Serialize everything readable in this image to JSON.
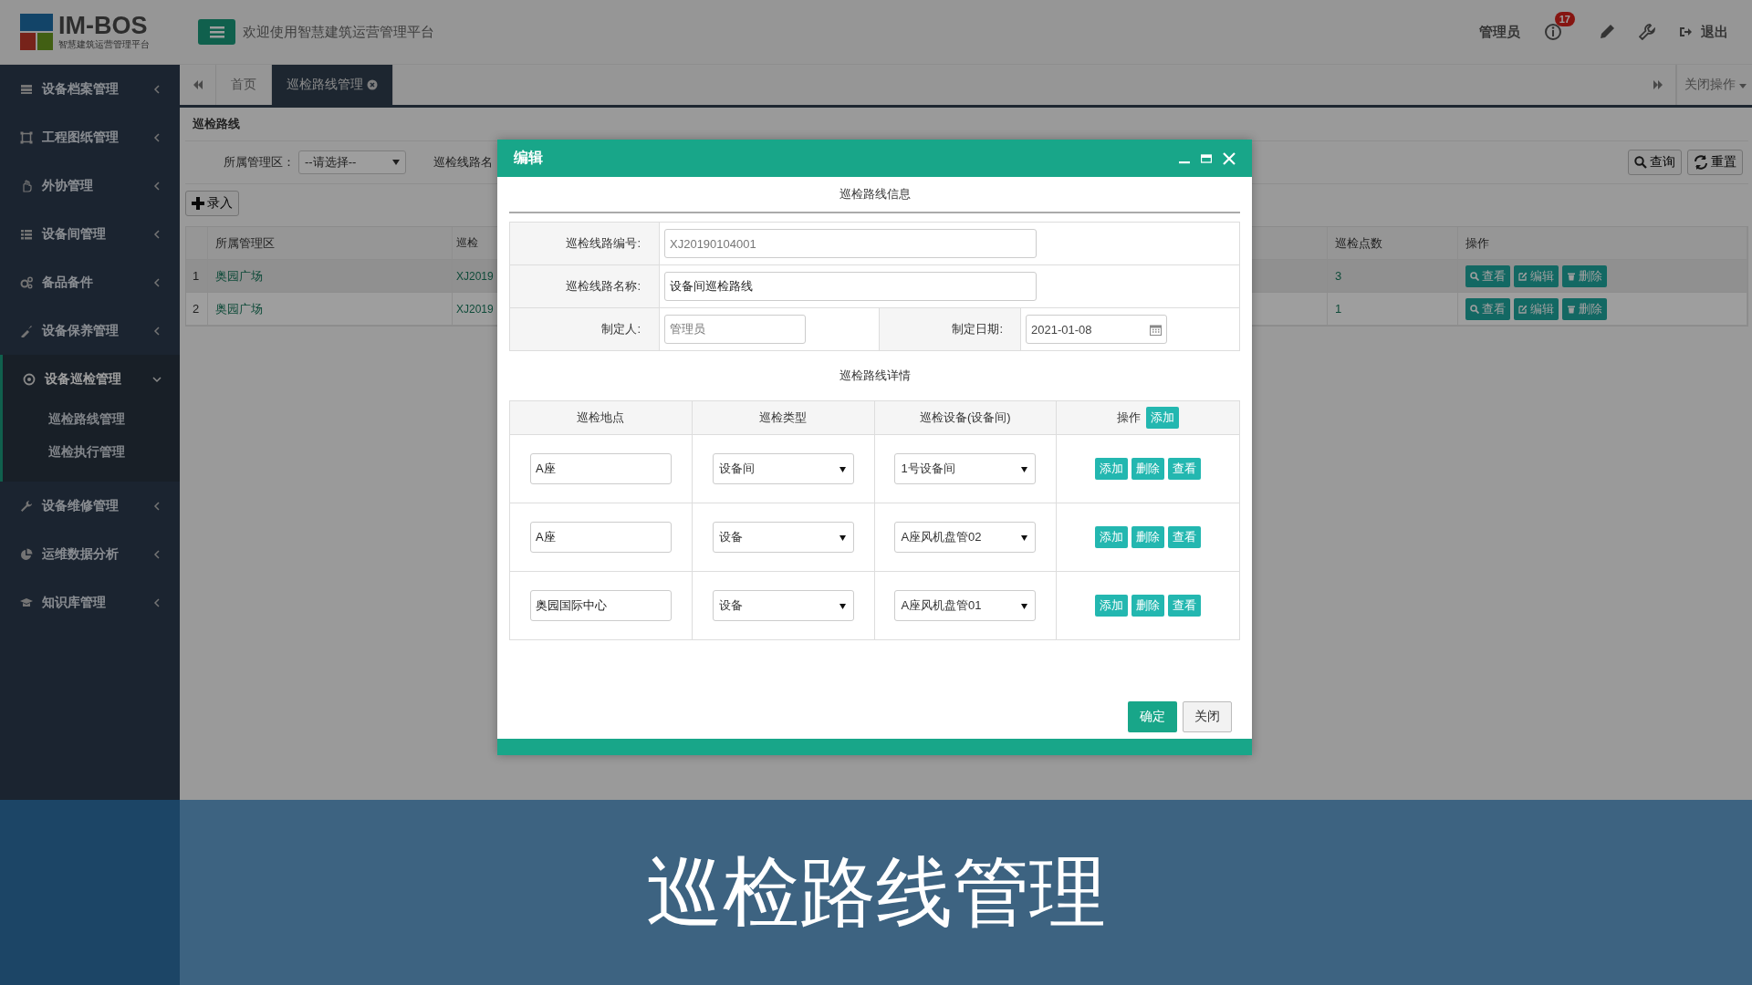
{
  "header": {
    "logo_title": "IM-BOS",
    "logo_subtitle": "智慧建筑运营管理平台",
    "welcome": "欢迎使用智慧建筑运营管理平台",
    "user": "管理员",
    "notification_count": "17",
    "logout": "退出"
  },
  "sidebar": {
    "items": [
      {
        "label": "设备档案管理",
        "expanded": false
      },
      {
        "label": "工程图纸管理",
        "expanded": false
      },
      {
        "label": "外协管理",
        "expanded": false
      },
      {
        "label": "设备间管理",
        "expanded": false
      },
      {
        "label": "备品备件",
        "expanded": false
      },
      {
        "label": "设备保养管理",
        "expanded": false
      },
      {
        "label": "设备巡检管理",
        "expanded": true,
        "children": [
          {
            "label": "巡检路线管理"
          },
          {
            "label": "巡检执行管理"
          }
        ]
      },
      {
        "label": "设备维修管理",
        "expanded": false
      },
      {
        "label": "运维数据分析",
        "expanded": false
      },
      {
        "label": "知识库管理",
        "expanded": false
      }
    ]
  },
  "tabs": [
    {
      "label": "首页",
      "selected": false,
      "closable": false
    },
    {
      "label": "巡检路线管理",
      "selected": true,
      "closable": true
    }
  ],
  "close_menu": "关闭操作",
  "page": {
    "breadcrumb": "巡检路线",
    "filters": [
      {
        "label": "所属管理区：",
        "value": "--请选择--"
      },
      {
        "label": "巡检线路名"
      }
    ],
    "search_button": "查询",
    "reset_button": "重置",
    "add_button": "录入",
    "table": {
      "columns": [
        "所属管理区",
        "巡检",
        "巡检点数",
        "操作"
      ],
      "rows": [
        {
          "index": "1",
          "area": "奥园广场",
          "code": "XJ2019",
          "points": "3",
          "selected": true,
          "actions": [
            "查看",
            "编辑",
            "删除"
          ]
        },
        {
          "index": "2",
          "area": "奥园广场",
          "code": "XJ2019",
          "points": "1",
          "selected": false,
          "actions": [
            "查看",
            "编辑",
            "删除"
          ]
        }
      ]
    }
  },
  "dialog": {
    "title": "编辑",
    "info_title": "巡检路线信息",
    "fields": [
      {
        "label": "巡检线路编号:",
        "value": "XJ20190104001",
        "readonly": true
      },
      {
        "label": "巡检线路名称:",
        "value": "设备间巡检路线",
        "readonly": false
      },
      {
        "label": "制定人:",
        "value": "管理员",
        "readonly": true
      },
      {
        "label": "制定日期:",
        "value": "2021-01-08",
        "readonly": false
      }
    ],
    "detail_title": "巡检路线详情",
    "detail_columns": [
      "巡检地点",
      "巡检类型",
      "巡检设备(设备间)",
      "操作"
    ],
    "detail_add": "添加",
    "detail_rows": [
      {
        "location": "A座",
        "type": "设备间",
        "device": "1号设备间",
        "actions": [
          "添加",
          "删除",
          "查看"
        ]
      },
      {
        "location": "A座",
        "type": "设备",
        "device": "A座风机盘管02",
        "actions": [
          "添加",
          "删除",
          "查看"
        ]
      },
      {
        "location": "奥园国际中心",
        "type": "设备",
        "device": "A座风机盘管01",
        "actions": [
          "添加",
          "删除",
          "查看"
        ]
      }
    ],
    "confirm": "确定",
    "close": "关闭"
  },
  "banner": {
    "caption": "巡检路线管理"
  }
}
